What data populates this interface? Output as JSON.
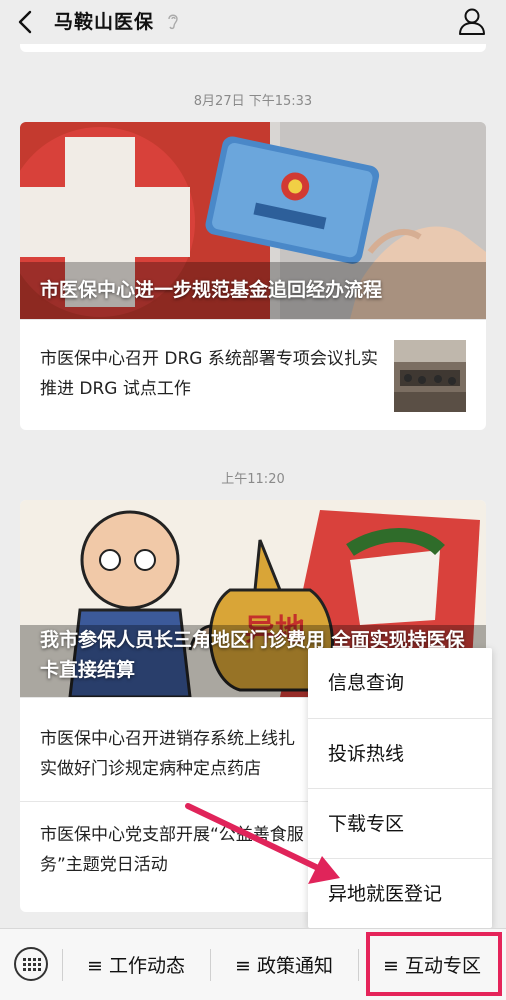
{
  "header": {
    "title": "马鞍山医保",
    "back_icon": "chevron-left-icon",
    "profile_icon": "person-icon"
  },
  "feed": [
    {
      "timestamp": "8月27日 下午15:33",
      "hero_title": "市医保中心进一步规范基金追回经办流程",
      "items": [
        {
          "text": "市医保中心召开 DRG 系统部署专项会议扎实推进 DRG 试点工作",
          "has_thumbnail": true
        }
      ]
    },
    {
      "timestamp": "上午11:20",
      "hero_title": "我市参保人员长三角地区门诊费用 全面实现持医保卡直接结算",
      "items": [
        {
          "text": "市医保中心召开进销存系统上线扎实做好门诊规定病种定点药店"
        },
        {
          "text": "市医保中心党支部开展“公益善食服务”主题党日活动"
        }
      ]
    }
  ],
  "popup_menu": {
    "items": [
      "信息查询",
      "投诉热线",
      "下载专区",
      "异地就医登记"
    ]
  },
  "bottom_menu": {
    "keyboard_icon": "keyboard-icon",
    "buttons": [
      "≡ 工作动态",
      "≡ 政策通知",
      "≡ 互动专区"
    ],
    "highlighted_index": 2
  },
  "colors": {
    "background": "#ededed",
    "highlight": "#e5245a",
    "arrow": "#e0245a"
  }
}
